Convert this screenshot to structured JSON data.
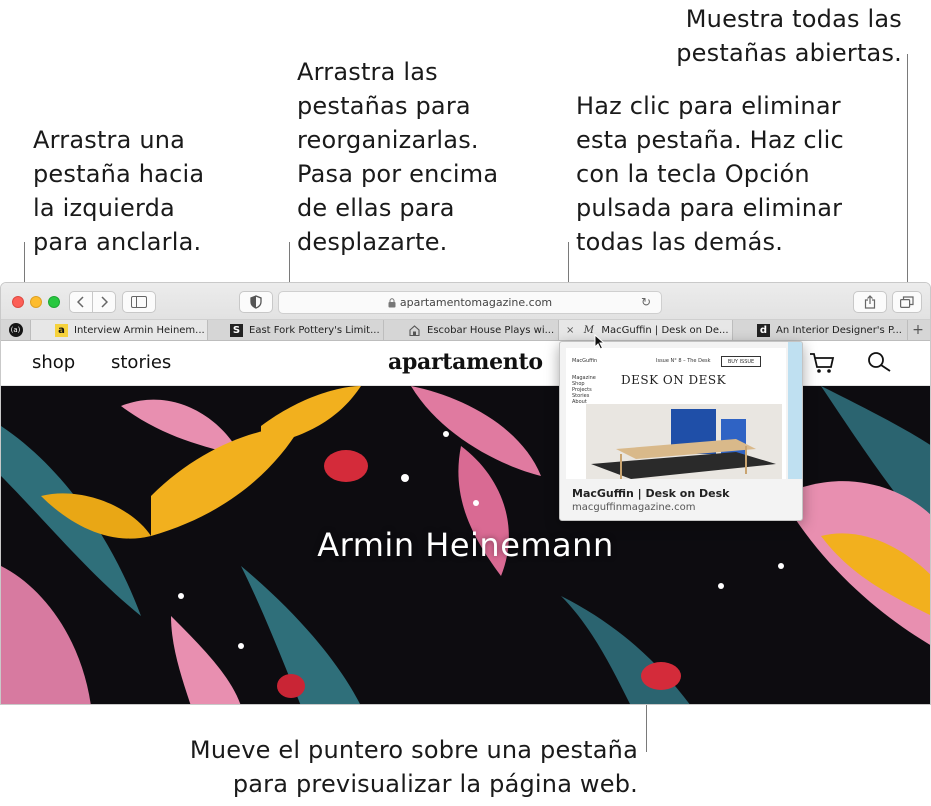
{
  "callouts": {
    "pin_tab": [
      "Arrastra una",
      "pestaña hacia",
      "la izquierda",
      "para anclarla."
    ],
    "reorder_tabs": [
      "Arrastra las",
      "pestañas para",
      "reorganizarlas.",
      "Pasa por encima",
      "de ellas para",
      "desplazarte."
    ],
    "close_tab": [
      "Haz clic para eliminar",
      "esta pestaña. Haz clic",
      "con la tecla Opción",
      "pulsada para eliminar",
      "todas las demás."
    ],
    "show_all_tabs": [
      "Muestra todas las",
      "pestañas abiertas."
    ],
    "preview_tab": [
      "Mueve el puntero sobre una pestaña",
      "para previsualizar la página web."
    ]
  },
  "browser": {
    "address": "apartamentomagazine.com",
    "pinned_tab_glyph": "(a)",
    "tabs": [
      {
        "title": "Interview Armin Heinem...",
        "favicon": "a"
      },
      {
        "title": "East Fork Pottery's Limit...",
        "favicon": "S"
      },
      {
        "title": "Escobar House Plays wi...",
        "favicon": "house-icon"
      },
      {
        "title": "MacGuffin | Desk on De...",
        "favicon": "M"
      },
      {
        "title": "An Interior Designer's P...",
        "favicon": "d"
      }
    ],
    "new_tab_glyph": "+",
    "close_glyph": "×"
  },
  "site": {
    "nav_left": [
      "shop",
      "stories"
    ],
    "logo": "apartamento",
    "hero_title": "Armin Heinemann",
    "colors": {
      "hero_bg": "#0d0c10",
      "accent_pink": "#e88fb0",
      "accent_yellow": "#f2b01e",
      "accent_teal": "#2f6f7a"
    }
  },
  "preview": {
    "page_label": "MacGuffin",
    "issue_label": "Issue N° 8 – The Desk",
    "buy_label": "BUY ISSUE",
    "menu": [
      "Magazine",
      "Shop",
      "Projects",
      "Stories",
      "About"
    ],
    "heading": "DESK ON DESK",
    "title": "MacGuffin | Desk on Desk",
    "url": "macguffinmagazine.com"
  }
}
